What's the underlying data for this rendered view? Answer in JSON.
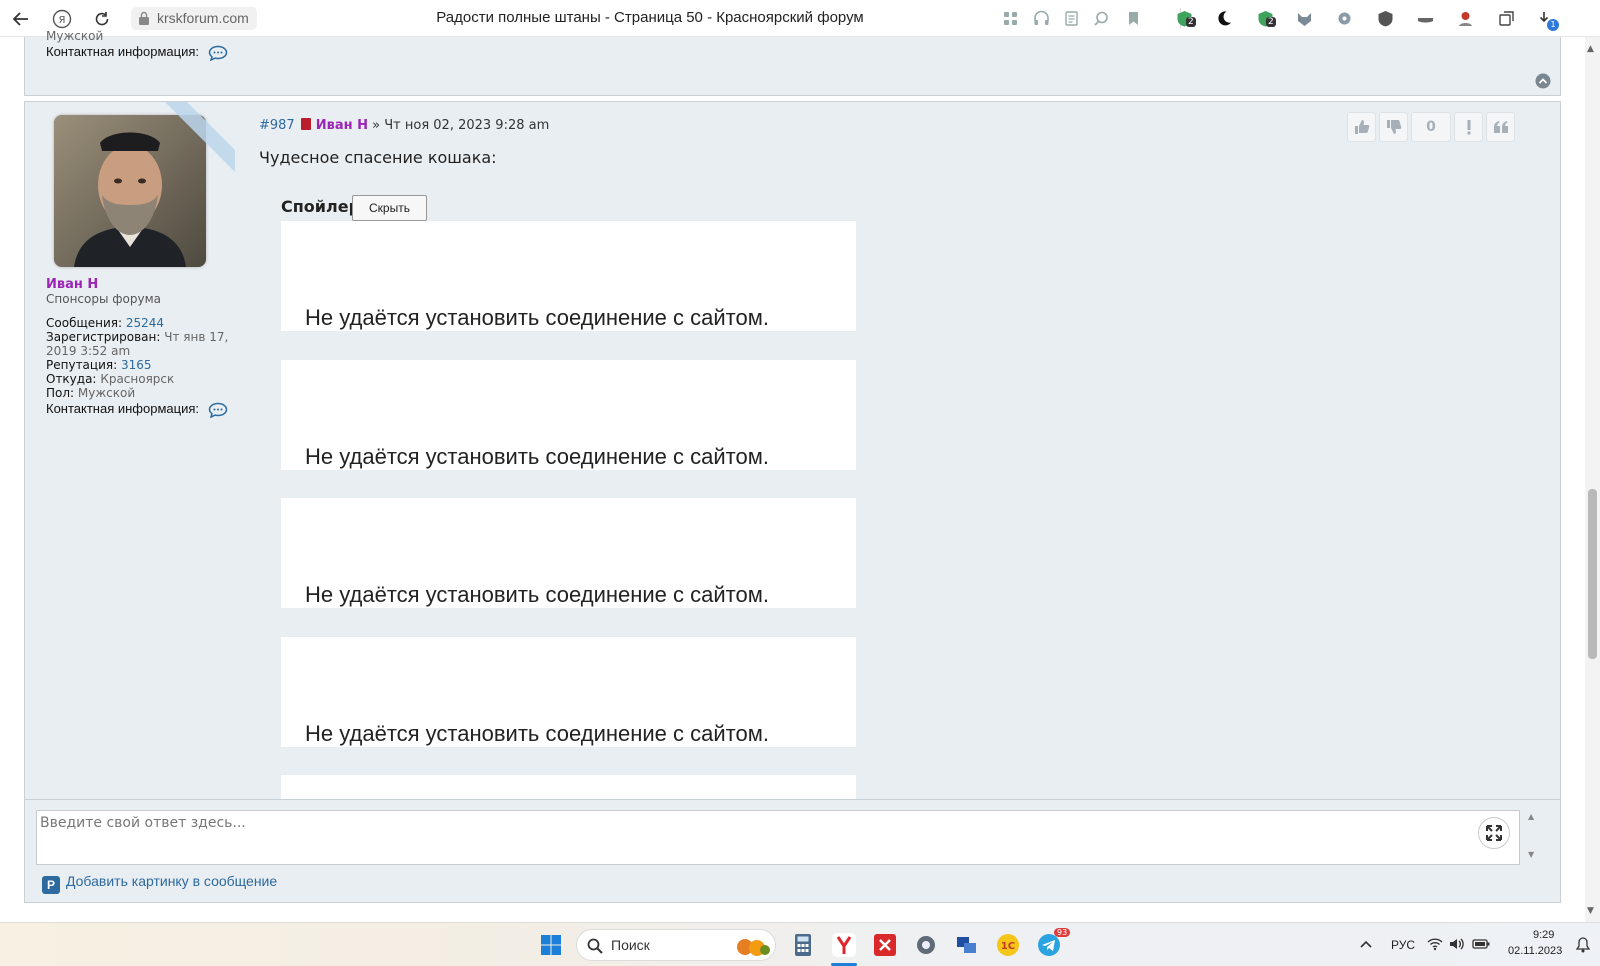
{
  "browser": {
    "domain": "krskforum.com",
    "title": "Радости полные штаны - Страница 50 - Красноярский форум",
    "tab_badges": [
      "2",
      "2",
      "1"
    ]
  },
  "prev_post": {
    "gender_value": "Мужской",
    "contact_label": "Контактная информация:"
  },
  "post": {
    "number": "#987",
    "author": "Иван Н",
    "separator": "»",
    "date": "Чт ноя 02, 2023 9:28 am",
    "body": "Чудесное спасение кошака:",
    "reputation_count": "0",
    "profile": {
      "username": "Иван Н",
      "rank": "Спонсоры форума",
      "messages_label": "Сообщения:",
      "messages": "25244",
      "registered_label": "Зарегистрирован:",
      "registered": "Чт янв 17, 2019 3:52 am",
      "reputation_label": "Репутация:",
      "reputation": "3165",
      "from_label": "Откуда:",
      "from": "Красноярск",
      "gender_label": "Пол:",
      "gender": "Мужской",
      "contact_label": "Контактная информация:"
    },
    "spoiler": {
      "title": "Спойлер",
      "button": "Скрыть",
      "frames": [
        {
          "message": "Не удаётся установить соединение с сайтом."
        },
        {
          "message": "Не удаётся установить соединение с сайтом."
        },
        {
          "message": "Не удаётся установить соединение с сайтом."
        },
        {
          "message": "Не удаётся установить соединение с сайтом."
        }
      ]
    }
  },
  "reply": {
    "placeholder": "Введите свой ответ здесь...",
    "add_image": "Добавить картинку в сообщение"
  },
  "taskbar": {
    "search_label": "Поиск",
    "language": "РУС",
    "time": "9:29",
    "date": "02.11.2023",
    "telegram_badge": "93"
  },
  "colors": {
    "post_bg": "#e9eef2",
    "author": "#9b26b6",
    "link": "#2c6aa0"
  }
}
